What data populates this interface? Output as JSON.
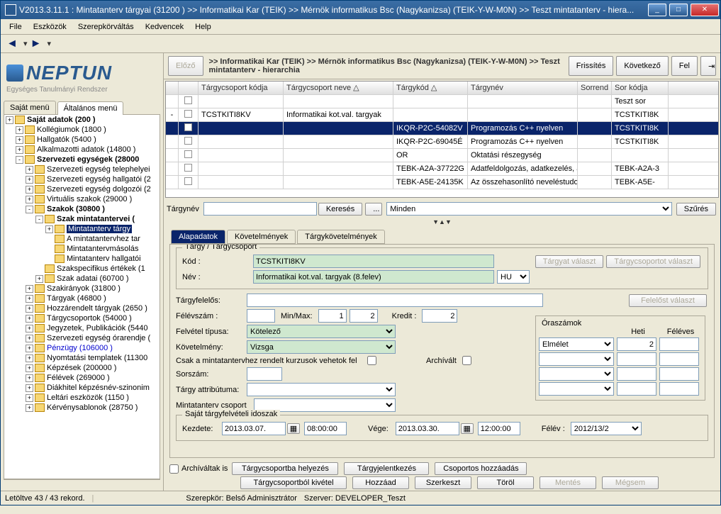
{
  "title": "V2013.3.11.1 : Mintatanterv tárgyai (31200  )  >> Informatikai Kar (TEIK)  >> Mérnök informatikus Bsc (Nagykanizsa) (TEIK-Y-W-M0N)  >> Teszt mintatanterv - hiera...",
  "menu": {
    "file": "File",
    "tools": "Eszközök",
    "role": "Szerepkörváltás",
    "fav": "Kedvencek",
    "help": "Help"
  },
  "logo": {
    "main": "NEPTUN",
    "sub": "Egységes Tanulmányi Rendszer"
  },
  "left_tabs": {
    "t1": "Saját menü",
    "t2": "Általános menü"
  },
  "tree": [
    {
      "d": 0,
      "t": "+",
      "b": 1,
      "l": "Saját adatok (200  )"
    },
    {
      "d": 1,
      "t": "+",
      "l": "Kollégiumok (1800  )"
    },
    {
      "d": 1,
      "t": "+",
      "l": "Hallgatók (5400  )"
    },
    {
      "d": 1,
      "t": "+",
      "l": "Alkalmazotti adatok (14800  )"
    },
    {
      "d": 1,
      "t": "-",
      "b": 1,
      "l": "Szervezeti egységek (28000"
    },
    {
      "d": 2,
      "t": "+",
      "l": "Szervezeti egység telephelyei"
    },
    {
      "d": 2,
      "t": "+",
      "l": "Szervezeti egység hallgatói (2"
    },
    {
      "d": 2,
      "t": "+",
      "l": "Szervezeti egység dolgozói (2"
    },
    {
      "d": 2,
      "t": "+",
      "l": "Virtuális szakok (29000  )"
    },
    {
      "d": 2,
      "t": "-",
      "b": 1,
      "l": "Szakok (30800  )"
    },
    {
      "d": 3,
      "t": "-",
      "b": 1,
      "l": "Szak mintatantervei ("
    },
    {
      "d": 4,
      "t": "+",
      "sel": 1,
      "l": "Mintatanterv tárgy"
    },
    {
      "d": 4,
      "t": " ",
      "l": "A mintatantervhez tar"
    },
    {
      "d": 4,
      "t": " ",
      "l": "Mintatantervmásolás"
    },
    {
      "d": 4,
      "t": " ",
      "l": "Mintatanterv hallgatói"
    },
    {
      "d": 3,
      "t": " ",
      "l": "Szakspecifikus értékek (1"
    },
    {
      "d": 3,
      "t": "+",
      "l": "Szak adatai (60700  )"
    },
    {
      "d": 2,
      "t": "+",
      "l": "Szakirányok (31800  )"
    },
    {
      "d": 2,
      "t": "+",
      "l": "Tárgyak (46800  )"
    },
    {
      "d": 2,
      "t": "+",
      "l": "Hozzárendelt tárgyak (2650  )"
    },
    {
      "d": 2,
      "t": "+",
      "l": "Tárgycsoportok (54000  )"
    },
    {
      "d": 2,
      "t": "+",
      "l": "Jegyzetek, Publikációk (5440"
    },
    {
      "d": 2,
      "t": "+",
      "l": "Szervezeti egység órarendje ("
    },
    {
      "d": 2,
      "t": "+",
      "blue": 1,
      "l": "Pénzügy (106000  )"
    },
    {
      "d": 2,
      "t": "+",
      "l": "Nyomtatási templatek (11300"
    },
    {
      "d": 2,
      "t": "+",
      "l": "Képzések (200000  )"
    },
    {
      "d": 2,
      "t": "+",
      "l": "Félévek (269000  )"
    },
    {
      "d": 2,
      "t": "+",
      "l": "Diákhitel képzésnév-szinonim"
    },
    {
      "d": 2,
      "t": "+",
      "l": "Leltári eszközök (1150  )"
    },
    {
      "d": 2,
      "t": "+",
      "l": "Kérvénysablonok (28750  )"
    }
  ],
  "head_btns": {
    "prev": "Előző",
    "refresh": "Frissítés",
    "next": "Következő",
    "up": "Fel"
  },
  "breadcrumb": ">> Informatikai Kar (TEIK) >> Mérnök informatikus Bsc (Nagykanizsa) (TEIK-Y-W-M0N) >> Teszt mintatanterv - hierarchia",
  "grid_headers": {
    "gkod": "Tárgycsoport kódja",
    "gnev": "Tárgycsoport neve",
    "tkod": "Tárgykód",
    "tnev": "Tárgynév",
    "sor": "Sorrend",
    "skod": "Sor kódja"
  },
  "grid_rows": [
    {
      "exp": " ",
      "kod": "",
      "nev": "",
      "tkod": "",
      "tnev": "",
      "sor": "",
      "skod": "Teszt sor"
    },
    {
      "exp": "-",
      "kod": "TCSTKITI8KV",
      "nev": "Informatikai kot.val. targyak",
      "tkod": "",
      "tnev": "",
      "sor": "",
      "skod": "TCSTKITI8K"
    },
    {
      "sel": 1,
      "kod": "",
      "nev": "",
      "tkod": "IKQR-P2C-54082V",
      "tnev": "Programozás C++ nyelven",
      "sor": "",
      "skod": "TCSTKITI8K"
    },
    {
      "kod": "",
      "nev": "",
      "tkod": "IKQR-P2C-69045É",
      "tnev": "Programozás C++ nyelven",
      "sor": "",
      "skod": "TCSTKITI8K"
    },
    {
      "kod": "",
      "nev": "",
      "tkod": "OR",
      "tnev": "Oktatási részegység",
      "sor": "",
      "skod": ""
    },
    {
      "kod": "",
      "nev": "",
      "tkod": "TEBK-A2A-37722G",
      "tnev": "Adatfeldolgozás, adatkezelés, an",
      "sor": "",
      "skod": "TEBK-A2A-3"
    },
    {
      "kod": "",
      "nev": "",
      "tkod": "TEBK-A5E-24135K",
      "tnev": "Az összehasonlító neveléstudom",
      "sor": "",
      "skod": "TEBK-A5E-"
    }
  ],
  "search": {
    "label": "Tárgynév",
    "btn": "Keresés",
    "dots": "...",
    "all": "Minden",
    "filter": "Szűrés"
  },
  "dtabs": {
    "t1": "Alapadatok",
    "t2": "Követelmények",
    "t3": "Tárgykövetelmények"
  },
  "form": {
    "grp_legend": "Tárgy / Tárgycsoport",
    "kod_l": "Kód :",
    "kod_v": "TCSTKITI8KV",
    "nev_l": "Név :",
    "nev_v": "Informatikai kot.val. targyak (8.felev)",
    "lang": "HU",
    "targy_btn": "Tárgyat választ",
    "csoport_btn": "Tárgycsoportot választ",
    "felelos_l": "Tárgyfelelős:",
    "felelos_btn": "Felelőst választ",
    "felevszam_l": "Félévszám :",
    "minmax": "Min/Max:",
    "min": "1",
    "max": "2",
    "kredit_l": "Kredit :",
    "kredit": "2",
    "felvtip_l": "Felvétel típusa:",
    "felvtip_v": "Kötelező",
    "kov_l": "Követelmény:",
    "kov_v": "Vizsga",
    "csak_l": "Csak a mintatantervhez rendelt kurzusok vehetok fel",
    "arch_l": "Archívált",
    "sorszam_l": "Sorszám:",
    "attr_l": "Tárgy attribútuma:",
    "mcsop_l": "Mintatanterv csoport",
    "ido_legend": "Saját tárgyfelvételi idoszak",
    "kezd_l": "Kezdete:",
    "kezd_d": "2013.03.07.",
    "kezd_t": "08:00:00",
    "vege_l": "Vége:",
    "vege_d": "2013.03.30.",
    "vege_t": "12:00:00",
    "felev_l": "Félév :",
    "felev_v": "2012/13/2",
    "ora_legend": "Óraszámok",
    "ora_heti": "Heti",
    "ora_feleves": "Féléves",
    "ora_elm": "Elmélet",
    "ora_elm_v": "2"
  },
  "bottom": {
    "arch_is": "Archíváltak is",
    "b1": "Tárgycsoportba helyezés",
    "b2": "Tárgyjelentkezés",
    "b3": "Csoportos hozzáadás",
    "b4": "Tárgycsoportból kivétel",
    "b5": "Hozzáad",
    "b6": "Szerkeszt",
    "b7": "Töröl",
    "b8": "Mentés",
    "b9": "Mégsem"
  },
  "status": {
    "rec": "Letöltve 43 / 43 rekord.",
    "role": "Szerepkör: Belső Adminisztrátor",
    "srv": "Szerver: DEVELOPER_Teszt"
  }
}
